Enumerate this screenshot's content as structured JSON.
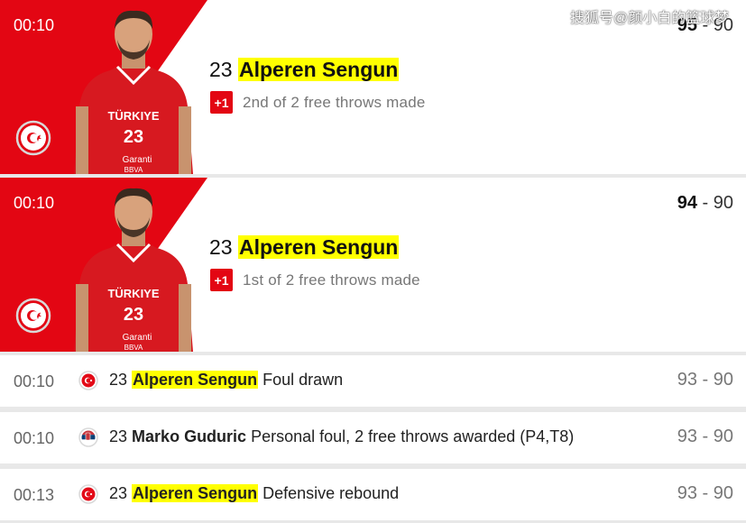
{
  "watermark": "搜狐号@颜小白的篮球梦",
  "events": [
    {
      "time": "00:10",
      "number": "23",
      "player": "Alperen Sengun",
      "points": "+1",
      "desc": "2nd of 2 free throws made",
      "score_home": "95",
      "score_sep": " - ",
      "score_away": "90",
      "team": "turkey",
      "team_colors": [
        "#e30a17",
        "#ffffff"
      ]
    },
    {
      "time": "00:10",
      "number": "23",
      "player": "Alperen Sengun",
      "points": "+1",
      "desc": "1st of 2 free throws made",
      "score_home": "94",
      "score_sep": " - ",
      "score_away": "90",
      "team": "turkey"
    }
  ],
  "log": [
    {
      "time": "00:10",
      "number": "23",
      "player": "Alperen Sengun",
      "desc": "Foul drawn",
      "score": "93 - 90",
      "team": "turkey",
      "highlight": true
    },
    {
      "time": "00:10",
      "number": "23",
      "player": "Marko Guduric",
      "desc": "Personal foul, 2 free throws awarded (P4,T8)",
      "score": "93 - 90",
      "team": "serbia",
      "highlight": false
    },
    {
      "time": "00:13",
      "number": "23",
      "player": "Alperen Sengun",
      "desc": "Defensive rebound",
      "score": "93 - 90",
      "team": "turkey",
      "highlight": true
    }
  ],
  "jersey": {
    "country": "TÜRKIYE",
    "number": "23",
    "sponsor": "Garanti",
    "sponsor2": "BBVA"
  }
}
